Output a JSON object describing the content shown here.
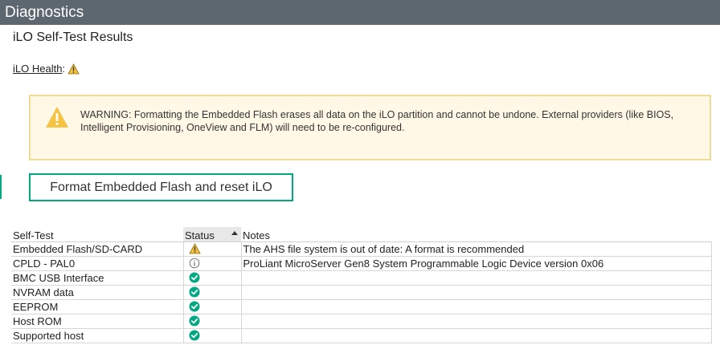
{
  "titlebar": {
    "title": "Diagnostics"
  },
  "section": {
    "title": "iLO Self-Test Results"
  },
  "health": {
    "label": "iLO Health",
    "separator": ":",
    "status_icon": "warning-icon"
  },
  "warning": {
    "icon": "warning-icon",
    "message": "WARNING: Formatting the Embedded Flash erases all data on the iLO partition and cannot be undone. External providers (like BIOS, Intelligent Provisioning, OneView and FLM) will need to be re-configured."
  },
  "format_button": {
    "label": "Format Embedded Flash and reset iLO"
  },
  "table": {
    "headers": {
      "test": "Self-Test",
      "status": "Status",
      "notes": "Notes"
    },
    "sort": {
      "column": "status",
      "direction": "ascending"
    },
    "rows": [
      {
        "test": "Embedded Flash/SD-CARD",
        "status": "warning",
        "notes": "The AHS file system is out of date: A format is recommended"
      },
      {
        "test": "CPLD - PAL0",
        "status": "info",
        "notes": "ProLiant MicroServer Gen8 System Programmable Logic Device version 0x06"
      },
      {
        "test": "BMC USB Interface",
        "status": "ok",
        "notes": ""
      },
      {
        "test": "NVRAM data",
        "status": "ok",
        "notes": ""
      },
      {
        "test": "EEPROM",
        "status": "ok",
        "notes": ""
      },
      {
        "test": "Host ROM",
        "status": "ok",
        "notes": ""
      },
      {
        "test": "Supported host",
        "status": "ok",
        "notes": ""
      }
    ]
  },
  "colors": {
    "titlebar_bg": "#5d6770",
    "accent": "#00a982",
    "warning": "#f5c242",
    "warning_bg": "#fff8e6",
    "ok": "#01a982"
  }
}
